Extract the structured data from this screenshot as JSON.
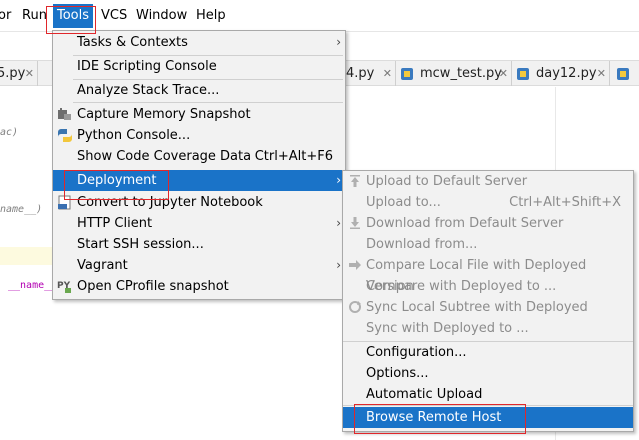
{
  "menubar": {
    "items": [
      {
        "label": "or"
      },
      {
        "label": "Run"
      },
      {
        "label": "Tools"
      },
      {
        "label": "VCS"
      },
      {
        "label": "Window"
      },
      {
        "label": "Help"
      }
    ]
  },
  "tabs": [
    {
      "label": "5.py"
    },
    {
      "label": "4.py"
    },
    {
      "label": "mcw_test.py"
    },
    {
      "label": "day12.py"
    }
  ],
  "editor": {
    "fragments": [
      "ac)",
      "name__)",
      "__name__"
    ]
  },
  "tools_menu": {
    "items": [
      {
        "label": "Tasks & Contexts",
        "shortcut": "",
        "submenu": true
      },
      {
        "label": "IDE Scripting Console",
        "shortcut": "",
        "submenu": false
      },
      {
        "label": "Analyze Stack Trace...",
        "shortcut": "",
        "submenu": false
      },
      {
        "label": "Capture Memory Snapshot",
        "shortcut": "",
        "submenu": false,
        "icon": "memory-snapshot-icon"
      },
      {
        "label": "Python Console...",
        "shortcut": "",
        "submenu": false,
        "icon": "python-icon"
      },
      {
        "label": "Show Code Coverage Data",
        "shortcut": "Ctrl+Alt+F6",
        "submenu": false
      },
      {
        "label": "Deployment",
        "shortcut": "",
        "submenu": true,
        "selected": true
      },
      {
        "label": "Convert to Jupyter Notebook",
        "shortcut": "",
        "submenu": false,
        "icon": "jupyter-icon"
      },
      {
        "label": "HTTP Client",
        "shortcut": "",
        "submenu": true
      },
      {
        "label": "Start SSH session...",
        "shortcut": "",
        "submenu": false
      },
      {
        "label": "Vagrant",
        "shortcut": "",
        "submenu": true
      },
      {
        "label": "Open CProfile snapshot",
        "shortcut": "",
        "submenu": false,
        "icon": "cprofile-icon"
      }
    ]
  },
  "deployment_menu": {
    "items": [
      {
        "label": "Upload to Default Server",
        "shortcut": "",
        "enabled": false,
        "icon": "upload-icon"
      },
      {
        "label": "Upload to...",
        "shortcut": "Ctrl+Alt+Shift+X",
        "enabled": false
      },
      {
        "label": "Download from Default Server",
        "shortcut": "",
        "enabled": false,
        "icon": "download-icon"
      },
      {
        "label": "Download from...",
        "shortcut": "",
        "enabled": false
      },
      {
        "label": "Compare Local File with Deployed Version",
        "shortcut": "",
        "enabled": false,
        "icon": "compare-icon"
      },
      {
        "label": "Compare with Deployed to ...",
        "shortcut": "",
        "enabled": false
      },
      {
        "label": "Sync Local Subtree with Deployed",
        "shortcut": "",
        "enabled": false,
        "icon": "sync-icon"
      },
      {
        "label": "Sync with Deployed to ...",
        "shortcut": "",
        "enabled": false
      },
      {
        "label": "Configuration...",
        "shortcut": "",
        "enabled": true
      },
      {
        "label": "Options...",
        "shortcut": "",
        "enabled": true
      },
      {
        "label": "Automatic Upload",
        "shortcut": "",
        "enabled": true
      },
      {
        "label": "Browse Remote Host",
        "shortcut": "",
        "enabled": true,
        "selected": true
      }
    ]
  },
  "colors": {
    "selection": "#1a73c8",
    "menu_bg": "#f2f2f2",
    "disabled_text": "#8c8c8c",
    "annotation_red": "#e0272b"
  }
}
